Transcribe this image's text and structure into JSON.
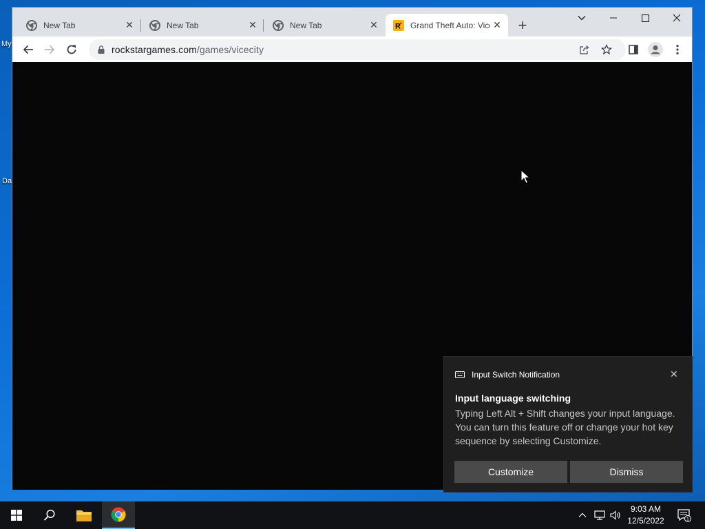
{
  "desktop": {
    "label_1": "My",
    "label_2": "Da"
  },
  "tabs": [
    {
      "label": "New Tab",
      "icon": "chrome-icon",
      "active": false
    },
    {
      "label": "New Tab",
      "icon": "chrome-icon",
      "active": false
    },
    {
      "label": "New Tab",
      "icon": "chrome-icon",
      "active": false
    },
    {
      "label": "Grand Theft Auto: Vice City",
      "icon": "rockstar-icon",
      "active": true
    }
  ],
  "window_controls": [
    "tab-search",
    "minimize",
    "maximize",
    "close"
  ],
  "address": {
    "host": "rockstargames.com",
    "path": "/games/vicecity"
  },
  "notification": {
    "app": "Input Switch Notification",
    "title": "Input language switching",
    "body": "Typing Left Alt + Shift changes your input language. You can turn this feature off or change your hot key sequence by selecting Customize.",
    "buttons": [
      "Customize",
      "Dismiss"
    ]
  },
  "taskbar": {
    "time": "9:03 AM",
    "date": "12/5/2022",
    "notification_count": "1"
  },
  "colors": {
    "accent": "#1a73e8",
    "page_background": "#070707",
    "toast_background": "#1f1f1f",
    "rockstar_yellow": "#fcaf17"
  }
}
